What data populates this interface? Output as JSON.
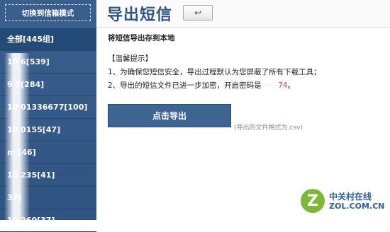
{
  "sidebar": {
    "switch_label": "切换到信箱模式",
    "groups": [
      {
        "label": "全部[445组]"
      },
      {
        "label": "10   6[539]"
      },
      {
        "label": "9   5[284]"
      },
      {
        "label": "10  01336677[100]"
      },
      {
        "label": "10  0155[47]"
      },
      {
        "label": "m   [46]"
      },
      {
        "label": "10   235[41]"
      },
      {
        "label": "     37]"
      },
      {
        "label": "10   260[37]"
      }
    ]
  },
  "header": {
    "title": "导出短信",
    "back_icon": "↩"
  },
  "content": {
    "section_title": "将短信导出存到本地",
    "tips_heading": "【温馨提示】",
    "tip1": "1、为确保您短信安全，导出过程默认为您屏蔽了所有下载工具；",
    "tip2_prefix": "2、导出的短信文件已进一步加密，开启密码是",
    "tip2_password_tail": "74",
    "tip2_suffix": "。",
    "export_button": "点击导出",
    "format_note": "(导出的文件格式为.csv)"
  },
  "watermark": {
    "mark": "Z",
    "cn": "中关村在线",
    "en": "ZOL.COM.CN"
  },
  "colors": {
    "sidebar": "#3a5f8e",
    "title": "#2f5686",
    "button": "#3c6592",
    "password_highlight": "#d84040"
  }
}
